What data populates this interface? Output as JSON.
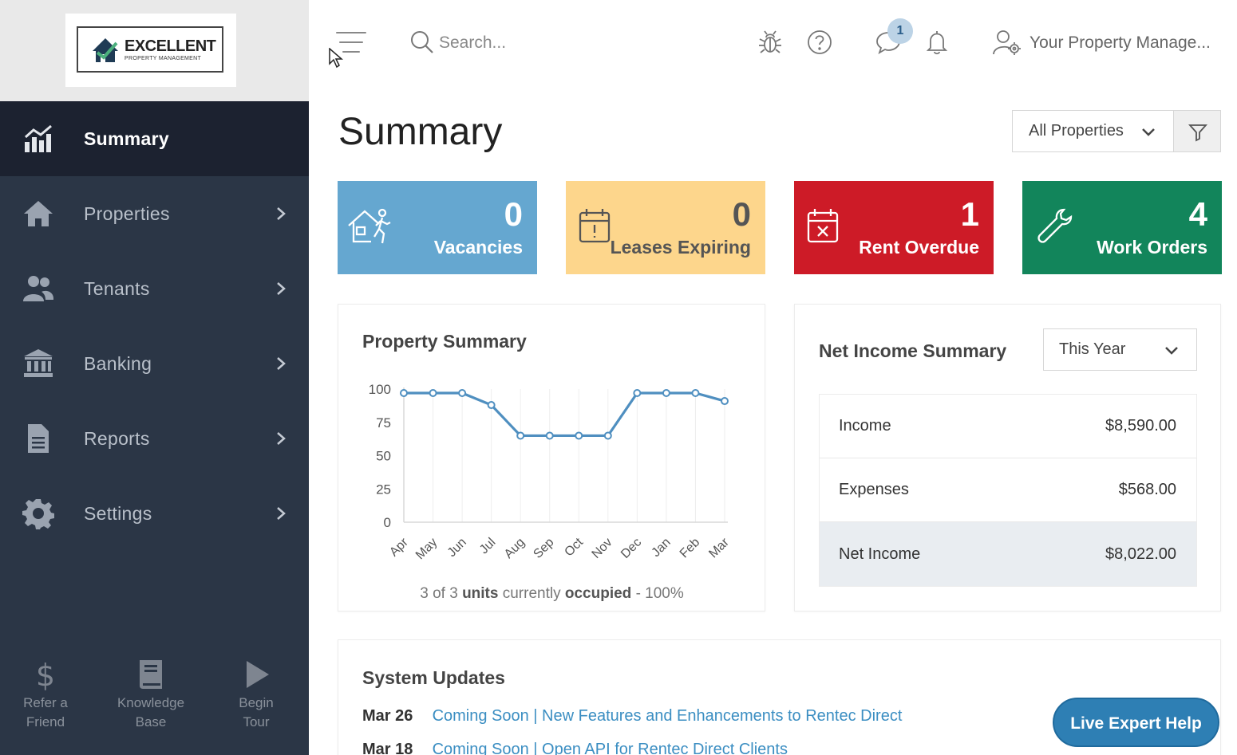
{
  "logo": {
    "main": "EXCELLENT",
    "sub": "PROPERTY MANAGEMENT"
  },
  "sidebar": {
    "items": [
      {
        "label": "Summary",
        "icon": "chart-icon",
        "active": true,
        "chevron": false
      },
      {
        "label": "Properties",
        "icon": "house-icon",
        "active": false,
        "chevron": true
      },
      {
        "label": "Tenants",
        "icon": "users-icon",
        "active": false,
        "chevron": true
      },
      {
        "label": "Banking",
        "icon": "bank-icon",
        "active": false,
        "chevron": true
      },
      {
        "label": "Reports",
        "icon": "document-icon",
        "active": false,
        "chevron": true
      },
      {
        "label": "Settings",
        "icon": "gear-icon",
        "active": false,
        "chevron": true
      }
    ],
    "bottom": [
      {
        "line1": "Refer a",
        "line2": "Friend",
        "icon": "dollar-icon"
      },
      {
        "line1": "Knowledge",
        "line2": "Base",
        "icon": "book-icon"
      },
      {
        "line1": "Begin",
        "line2": "Tour",
        "icon": "play-icon"
      }
    ]
  },
  "topbar": {
    "search_placeholder": "Search...",
    "message_badge": "1",
    "user_name": "Your Property Manage..."
  },
  "main": {
    "title": "Summary",
    "property_filter": "All Properties",
    "cards": [
      {
        "value": "0",
        "label": "Vacancies",
        "bg": "#65a7d0",
        "fg": "#ffffff",
        "icon": "house-person-icon"
      },
      {
        "value": "0",
        "label": "Leases Expiring",
        "bg": "#fdd68c",
        "fg": "#555555",
        "icon": "calendar-alert-icon"
      },
      {
        "value": "1",
        "label": "Rent Overdue",
        "bg": "#cd1b27",
        "fg": "#ffffff",
        "icon": "calendar-x-icon"
      },
      {
        "value": "4",
        "label": "Work Orders",
        "bg": "#12855b",
        "fg": "#ffffff",
        "icon": "wrench-icon"
      }
    ],
    "property_summary": {
      "title": "Property Summary",
      "caption_count": "3 of 3",
      "caption_units": "units",
      "caption_mid": "currently",
      "caption_occupied": "occupied",
      "caption_pct": "- 100%"
    },
    "net_income": {
      "title": "Net Income Summary",
      "period": "This Year",
      "rows": [
        {
          "label": "Income",
          "value": "$8,590.00"
        },
        {
          "label": "Expenses",
          "value": "$568.00"
        },
        {
          "label": "Net Income",
          "value": "$8,022.00"
        }
      ]
    },
    "updates": {
      "title": "System Updates",
      "items": [
        {
          "date": "Mar 26",
          "text": "Coming Soon | New Features and Enhancements to Rentec Direct"
        },
        {
          "date": "Mar 18",
          "text": "Coming Soon | Open API for Rentec Direct Clients"
        }
      ]
    },
    "live_help": "Live Expert Help"
  },
  "chart_data": {
    "type": "line",
    "categories": [
      "Apr",
      "May",
      "Jun",
      "Jul",
      "Aug",
      "Sep",
      "Oct",
      "Nov",
      "Dec",
      "Jan",
      "Feb",
      "Mar"
    ],
    "series": [
      {
        "values": [
          97,
          97,
          97,
          88,
          65,
          65,
          65,
          65,
          97,
          97,
          97,
          91
        ],
        "color": "#4f8fc0"
      }
    ],
    "y_ticks": [
      0,
      25,
      50,
      75,
      100
    ],
    "ylim": [
      0,
      100
    ],
    "grid": "vertical"
  }
}
